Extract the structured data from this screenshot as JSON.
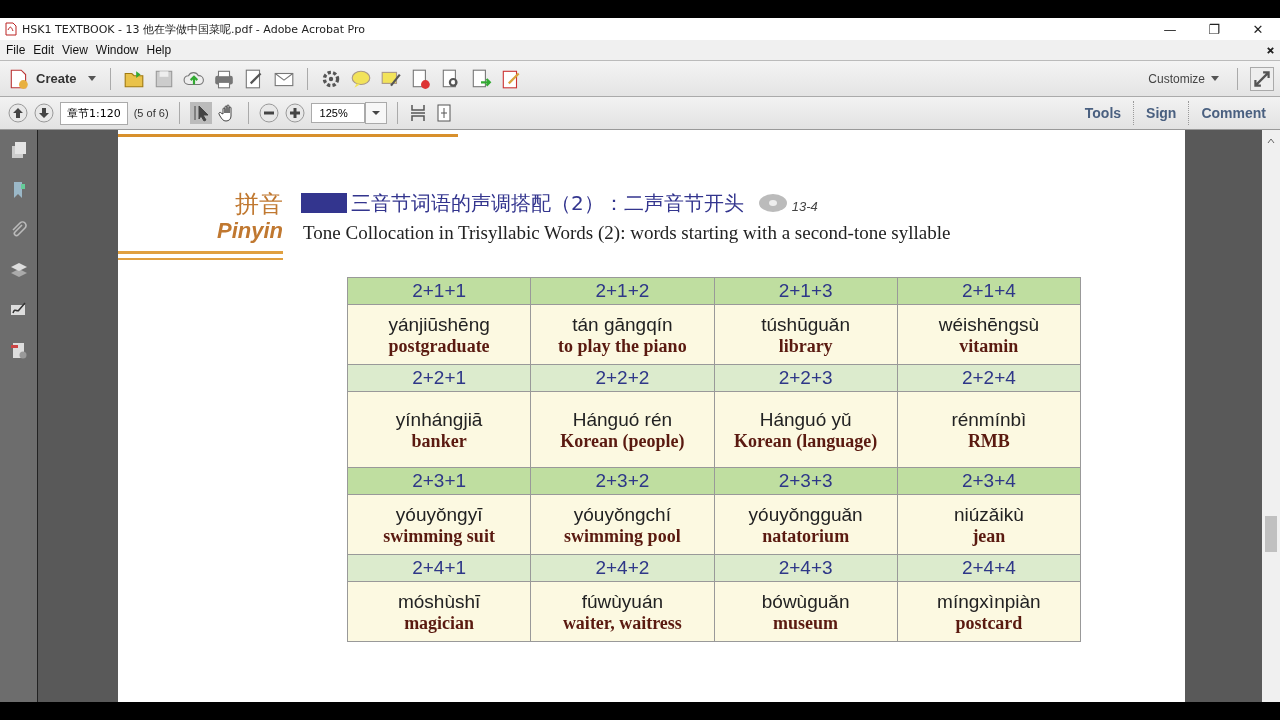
{
  "window": {
    "title": "HSK1 TEXTBOOK - 13 他在学做中国菜呢.pdf - Adobe Acrobat Pro",
    "controls": [
      "—",
      "❐",
      "✕"
    ]
  },
  "menu": [
    "File",
    "Edit",
    "View",
    "Window",
    "Help"
  ],
  "toolbar": {
    "create": "Create",
    "customize": "Customize"
  },
  "nav": {
    "page_field": "章节1:120",
    "page_count": "(5 of 6)",
    "zoom": "125%",
    "panels": [
      {
        "label": "Tools"
      },
      {
        "label": "Sign"
      },
      {
        "label": "Comment"
      }
    ]
  },
  "page": {
    "section_cn": "拼音",
    "section_en": "Pinyin",
    "heading_cn": "三音节词语的声调搭配（2）：二声音节开头",
    "track": "13-4",
    "heading_en": "Tone Collocation in Trisyllabic Words (2): words starting with a second-tone syllable",
    "groups": [
      {
        "patterns": [
          "2+1+1",
          "2+1+2",
          "2+1+3",
          "2+1+4"
        ],
        "words": [
          {
            "pinyin": "yánjiūshēng",
            "meaning": "postgraduate"
          },
          {
            "pinyin": "tán gāngqín",
            "meaning": "to play the piano"
          },
          {
            "pinyin": "túshūguǎn",
            "meaning": "library"
          },
          {
            "pinyin": "wéishēngsù",
            "meaning": "vitamin"
          }
        ]
      },
      {
        "patterns": [
          "2+2+1",
          "2+2+2",
          "2+2+3",
          "2+2+4"
        ],
        "words": [
          {
            "pinyin": "yínhángjiā",
            "meaning": "banker"
          },
          {
            "pinyin": "Hánguó rén",
            "meaning": "Korean (people)"
          },
          {
            "pinyin": "Hánguó yǔ",
            "meaning": "Korean (language)"
          },
          {
            "pinyin": "rénmínbì",
            "meaning": "RMB"
          }
        ]
      },
      {
        "patterns": [
          "2+3+1",
          "2+3+2",
          "2+3+3",
          "2+3+4"
        ],
        "words": [
          {
            "pinyin": "yóuyǒngyī",
            "meaning": "swimming suit"
          },
          {
            "pinyin": "yóuyǒngchí",
            "meaning": "swimming pool"
          },
          {
            "pinyin": "yóuyǒngguǎn",
            "meaning": "natatorium"
          },
          {
            "pinyin": "niúzǎikù",
            "meaning": "jean"
          }
        ]
      },
      {
        "patterns": [
          "2+4+1",
          "2+4+2",
          "2+4+3",
          "2+4+4"
        ],
        "words": [
          {
            "pinyin": "móshùshī",
            "meaning": "magician"
          },
          {
            "pinyin": "fúwùyuán",
            "meaning": "waiter, waitress"
          },
          {
            "pinyin": "bówùguǎn",
            "meaning": "museum"
          },
          {
            "pinyin": "míngxìnpiàn",
            "meaning": "postcard"
          }
        ]
      }
    ]
  }
}
